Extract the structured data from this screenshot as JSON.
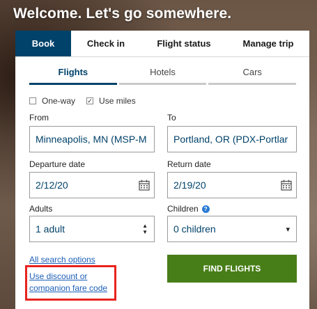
{
  "header": {
    "title": "Welcome. Let's go somewhere."
  },
  "tabs": [
    {
      "label": "Book"
    },
    {
      "label": "Check in"
    },
    {
      "label": "Flight status"
    },
    {
      "label": "Manage trip"
    }
  ],
  "subtabs": [
    {
      "label": "Flights"
    },
    {
      "label": "Hotels"
    },
    {
      "label": "Cars"
    }
  ],
  "options": {
    "one_way": {
      "label": "One-way",
      "checked": false
    },
    "use_miles": {
      "label": "Use miles",
      "checked": true,
      "mark": "✓"
    }
  },
  "form": {
    "from": {
      "label": "From",
      "value": "Minneapolis, MN (MSP-M"
    },
    "to": {
      "label": "To",
      "value": "Portland, OR (PDX-Portlar"
    },
    "departure": {
      "label": "Departure date",
      "value": "2/12/20"
    },
    "return": {
      "label": "Return date",
      "value": "2/19/20"
    },
    "adults": {
      "label": "Adults",
      "value": "1 adult"
    },
    "children": {
      "label": "Children",
      "value": "0 children",
      "help": "?"
    }
  },
  "links": {
    "all_search_options": "All search options",
    "discount_line1": "Use discount or",
    "discount_line2": "companion fare code"
  },
  "actions": {
    "find_flights": "FIND FLIGHTS"
  },
  "colors": {
    "active_tab": "#01426a",
    "find_button": "#487e18",
    "link": "#1d5fb8",
    "highlight_box": "#e8231e"
  }
}
